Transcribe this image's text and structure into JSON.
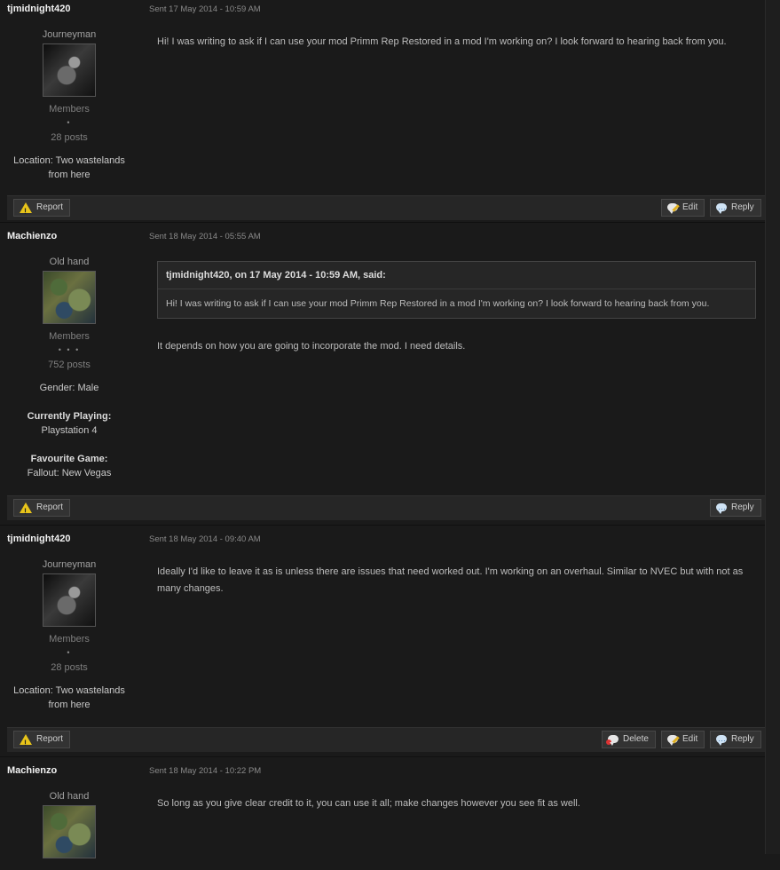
{
  "messages": [
    {
      "author": "tjmidnight420",
      "sent": "Sent 17 May 2014 - 10:59 AM",
      "rank": "Journeyman",
      "avatar_icon": "robot-soldier-avatar",
      "group": "Members",
      "pips": "•",
      "posts": "28 posts",
      "location_label": "Location:",
      "location_value": "Two wastelands from here",
      "text": "Hi! I was writing to ask if I can use your mod Primm Rep Restored in a mod I'm working on? I look forward to hearing back from you.",
      "report": "Report",
      "edit": "Edit",
      "reply": "Reply"
    },
    {
      "author": "Machienzo",
      "sent": "Sent 18 May 2014 - 05:55 AM",
      "rank": "Old hand",
      "avatar_icon": "snake-camouflage-avatar",
      "group": "Members",
      "pips": "• • •",
      "posts": "752 posts",
      "gender_label": "Gender:",
      "gender_value": "Male",
      "playing_label": "Currently Playing:",
      "playing_value": "Playstation 4",
      "fav_label": "Favourite Game:",
      "fav_value": "Fallout: New Vegas",
      "quote_cite": "tjmidnight420, on 17 May 2014 - 10:59 AM, said:",
      "quote_text": "Hi! I was writing to ask if I can use your mod Primm Rep Restored in a mod I'm working on? I look forward to hearing back from you.",
      "text": "It depends on how you are going to incorporate the mod. I need details.",
      "report": "Report",
      "reply": "Reply"
    },
    {
      "author": "tjmidnight420",
      "sent": "Sent 18 May 2014 - 09:40 AM",
      "rank": "Journeyman",
      "avatar_icon": "robot-soldier-avatar",
      "group": "Members",
      "pips": "•",
      "posts": "28 posts",
      "location_label": "Location:",
      "location_value": "Two wastelands from here",
      "text": "Ideally I'd like to leave it as is unless there are issues that need worked out. I'm working on an overhaul. Similar to NVEC but with not as many changes.",
      "report": "Report",
      "delete": "Delete",
      "edit": "Edit",
      "reply": "Reply"
    },
    {
      "author": "Machienzo",
      "sent": "Sent 18 May 2014 - 10:22 PM",
      "rank": "Old hand",
      "avatar_icon": "snake-camouflage-avatar",
      "text": "So long as you give clear credit to it, you can use it all; make changes however you see fit as well."
    }
  ],
  "colors": {
    "background": "#1a1a1a",
    "author": "#f2f2f2",
    "meta": "#8a8a8a",
    "button_bg": "#333333",
    "warning": "#e8c41a"
  }
}
